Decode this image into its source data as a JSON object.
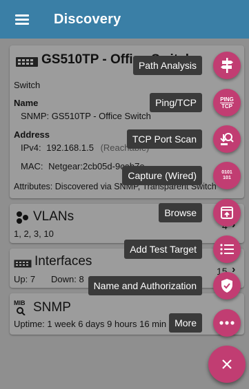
{
  "appbar": {
    "title": "Discovery"
  },
  "device_card": {
    "name": "GS510TP - Office Switch",
    "type": "Switch",
    "name_label": "Name",
    "name_value": "SNMP:  GS510TP - Office Switch",
    "address_label": "Address",
    "ipv4_label": "IPv4:",
    "ipv4_value": "192.168.1.5",
    "ipv4_status": "(Reachable)",
    "mac_label": "MAC:",
    "mac_value": "Netgear:2cb05d-9cab7e",
    "attributes_label": "Attributes:",
    "attributes_value": "Discovered via SNMP, Transparent Switch"
  },
  "vlans_card": {
    "title": "VLANs",
    "values": "1, 2, 3, 10",
    "count": "4"
  },
  "interfaces_card": {
    "title": "Interfaces",
    "up": "Up: 7",
    "down": "Down: 8",
    "count": "15"
  },
  "snmp_card": {
    "title": "SNMP",
    "uptime": "Uptime:  1 week 6 days 9 hours 16 min"
  },
  "speed_dial": {
    "actions": [
      {
        "label": "Path Analysis",
        "icon": "signpost-icon"
      },
      {
        "label": "Ping/TCP",
        "icon": "ping-tcp-icon",
        "icon_text_top": "PING",
        "icon_text_bottom": "TCP"
      },
      {
        "label": "TCP Port Scan",
        "icon": "port-scan-icon"
      },
      {
        "label": "Capture (Wired)",
        "icon": "capture-icon",
        "icon_text_top": "0101",
        "icon_text_bottom": "101"
      },
      {
        "label": "Browse",
        "icon": "browse-icon"
      },
      {
        "label": "Add Test Target",
        "icon": "list-icon"
      },
      {
        "label": "Name and Authorization",
        "icon": "shield-check-icon"
      },
      {
        "label": "More",
        "icon": "more-dots-icon"
      }
    ],
    "close_icon": "close-icon"
  },
  "colors": {
    "appbar": "#3a7fa6",
    "accent": "#c13d72",
    "label_bg": "#3a3a3a"
  }
}
